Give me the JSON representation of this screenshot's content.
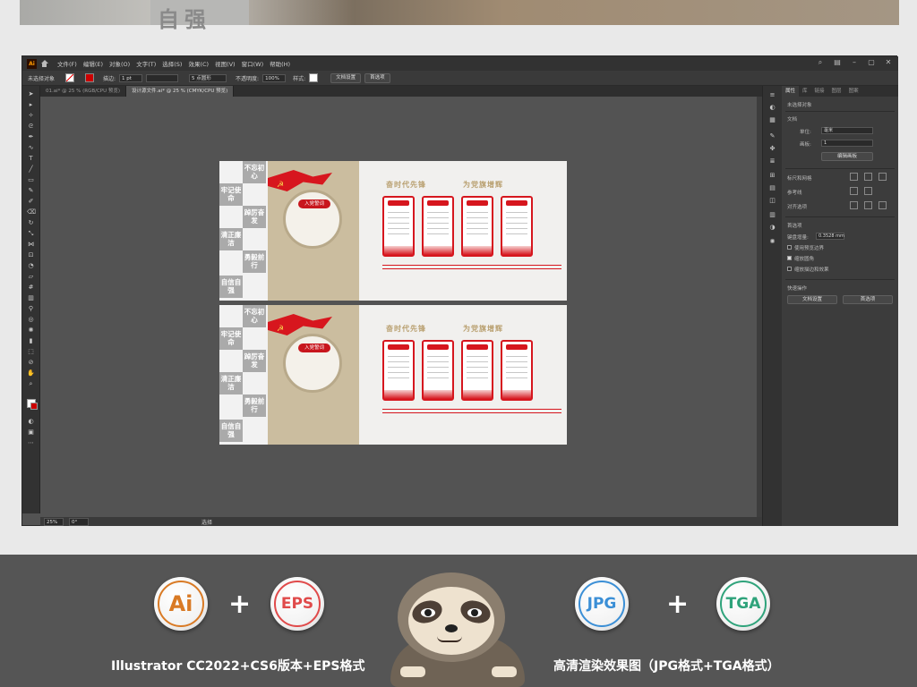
{
  "photo": {
    "sign_text": "自强"
  },
  "app": {
    "logo": "Ai",
    "menu": [
      "文件(F)",
      "编辑(E)",
      "对象(O)",
      "文字(T)",
      "选择(S)",
      "效果(C)",
      "视图(V)",
      "窗口(W)",
      "帮助(H)"
    ],
    "control_bar": {
      "selection_label": "未选择对象",
      "stroke_label": "描边:",
      "stroke_value": "1 pt",
      "brush_value": "5 点圆形",
      "opacity_label": "不透明度:",
      "opacity_value": "100%",
      "style_label": "样式:",
      "doc_setup": "文档设置",
      "preferences": "首选项"
    },
    "tabs": [
      {
        "label": "01.ai* @ 25 % (RGB/CPU 预览)",
        "active": false
      },
      {
        "label": "设计源文件.ai* @ 25 % (CMYK/CPU 预览)",
        "active": true
      }
    ],
    "status": {
      "zoom": "25%",
      "angle": "0°",
      "mode": "选择"
    },
    "properties": {
      "tabs": [
        "属性",
        "库",
        "链接",
        "图层",
        "图案"
      ],
      "no_selection": "未选择对象",
      "doc_header": "文档",
      "unit_label": "单位:",
      "unit_value": "毫米",
      "artboard_label": "画板:",
      "artboard_value": "1",
      "edit_artboard": "编辑画板",
      "ruler_grid": "标尺和网格",
      "guides": "参考线",
      "snap": "对齐选项",
      "preferences_header": "首选项",
      "keyboard_increment_label": "键盘增量:",
      "keyboard_increment_value": "0.3528 mm",
      "checkbox1": "使用预览边界",
      "checkbox2": "缩放圆角",
      "checkbox3": "缩放描边和效果",
      "quick_actions": "快速操作",
      "qa_doc_setup": "文档设置",
      "qa_preferences": "首选项"
    }
  },
  "artboards": [
    {
      "slogans": [
        "不忘初心",
        "牢记使命",
        "踔厉奋发",
        "清正廉洁",
        "勇毅前行",
        "自信自强"
      ],
      "pill": "入党誓词",
      "head1": "奋时代先锋",
      "head2": "为党旗增辉"
    },
    {
      "slogans": [
        "不忘初心",
        "牢记使命",
        "踔厉奋发",
        "清正廉洁",
        "勇毅前行",
        "自信自强"
      ],
      "pill": "入党誓词",
      "head1": "奋时代先锋",
      "head2": "为党旗增辉"
    }
  ],
  "formats": {
    "ai": "Ai",
    "eps": "EPS",
    "jpg": "JPG",
    "tga": "TGA",
    "plus": "+",
    "caption_left": "Illustrator CC2022+CS6版本+EPS格式",
    "caption_right": "高清渲染效果图（JPG格式+TGA格式）"
  }
}
